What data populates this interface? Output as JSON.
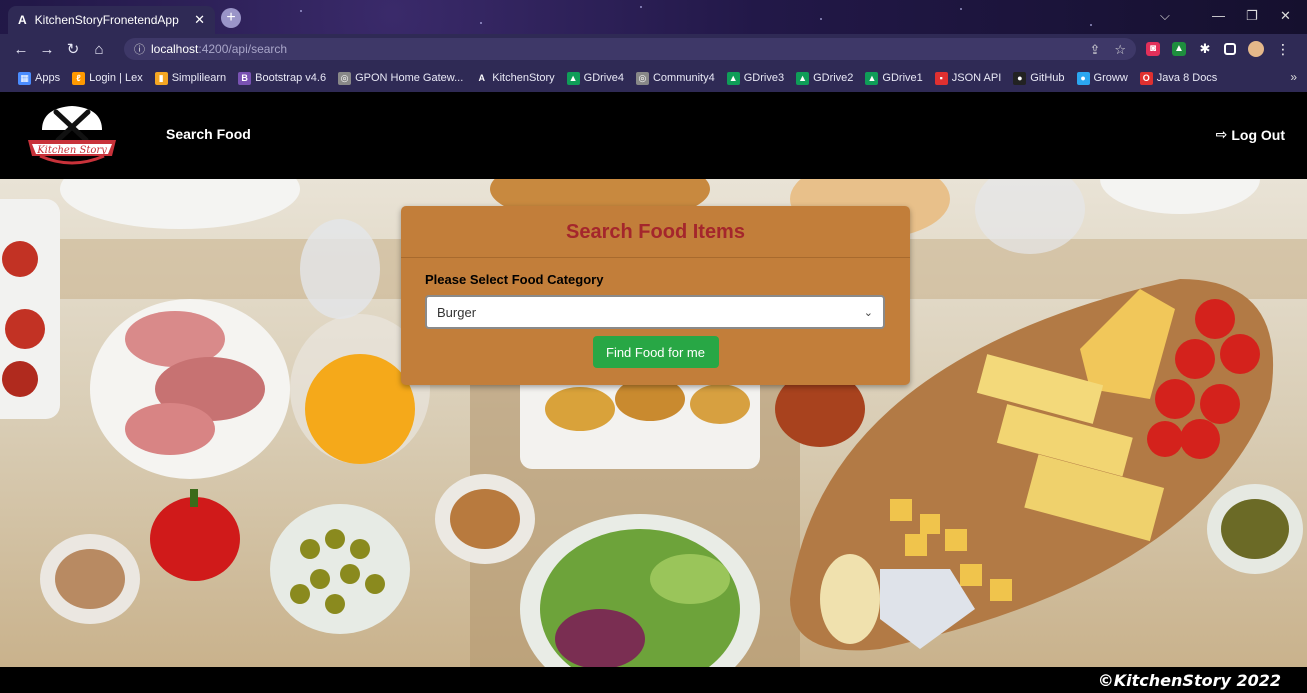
{
  "browser": {
    "tab_title": "KitchenStoryFronetendApp",
    "tab_icon": "A",
    "tab_close": "✕",
    "url_host": "localhost",
    "url_path": ":4200/api/search",
    "bookmarks": [
      {
        "label": "Apps",
        "icon": "apps-grid-icon",
        "color": "#4a8cff"
      },
      {
        "label": "Login | Lex",
        "icon": "lex-icon",
        "color": "#ff9900"
      },
      {
        "label": "Simplilearn",
        "icon": "simplilearn-icon",
        "color": "#f5a623"
      },
      {
        "label": "Bootstrap v4.6",
        "icon": "bootstrap-icon",
        "color": "#7952b3"
      },
      {
        "label": "GPON Home Gatew...",
        "icon": "globe-icon",
        "color": "#888888"
      },
      {
        "label": "KitchenStory",
        "icon": "kitchenstory-icon",
        "color": "#2f2a55"
      },
      {
        "label": "GDrive4",
        "icon": "gdrive-icon",
        "color": "#0f9d58"
      },
      {
        "label": "Community4",
        "icon": "globe-icon",
        "color": "#888888"
      },
      {
        "label": "GDrive3",
        "icon": "gdrive-icon",
        "color": "#0f9d58"
      },
      {
        "label": "GDrive2",
        "icon": "gdrive-icon",
        "color": "#0f9d58"
      },
      {
        "label": "GDrive1",
        "icon": "gdrive-icon",
        "color": "#0f9d58"
      },
      {
        "label": "JSON API",
        "icon": "json-api-icon",
        "color": "#e03030"
      },
      {
        "label": "GitHub",
        "icon": "github-icon",
        "color": "#222222"
      },
      {
        "label": "Groww",
        "icon": "groww-icon",
        "color": "#2ba6f0"
      },
      {
        "label": "Java 8 Docs",
        "icon": "oracle-icon",
        "color": "#e03030"
      }
    ]
  },
  "header": {
    "logo_text": "Kitchen Story",
    "nav_search": "Search Food",
    "logout_label": "Log Out"
  },
  "card": {
    "title": "Search Food Items",
    "select_label": "Please Select Food Category",
    "selected_category": "Burger",
    "button_label": "Find Food for me"
  },
  "footer": {
    "copyright": "©KitchenStory 2022"
  },
  "colors": {
    "card_bg": "#c27e3a",
    "card_title": "#a4262c",
    "button_green": "#28a745",
    "header_bg": "#000000"
  }
}
